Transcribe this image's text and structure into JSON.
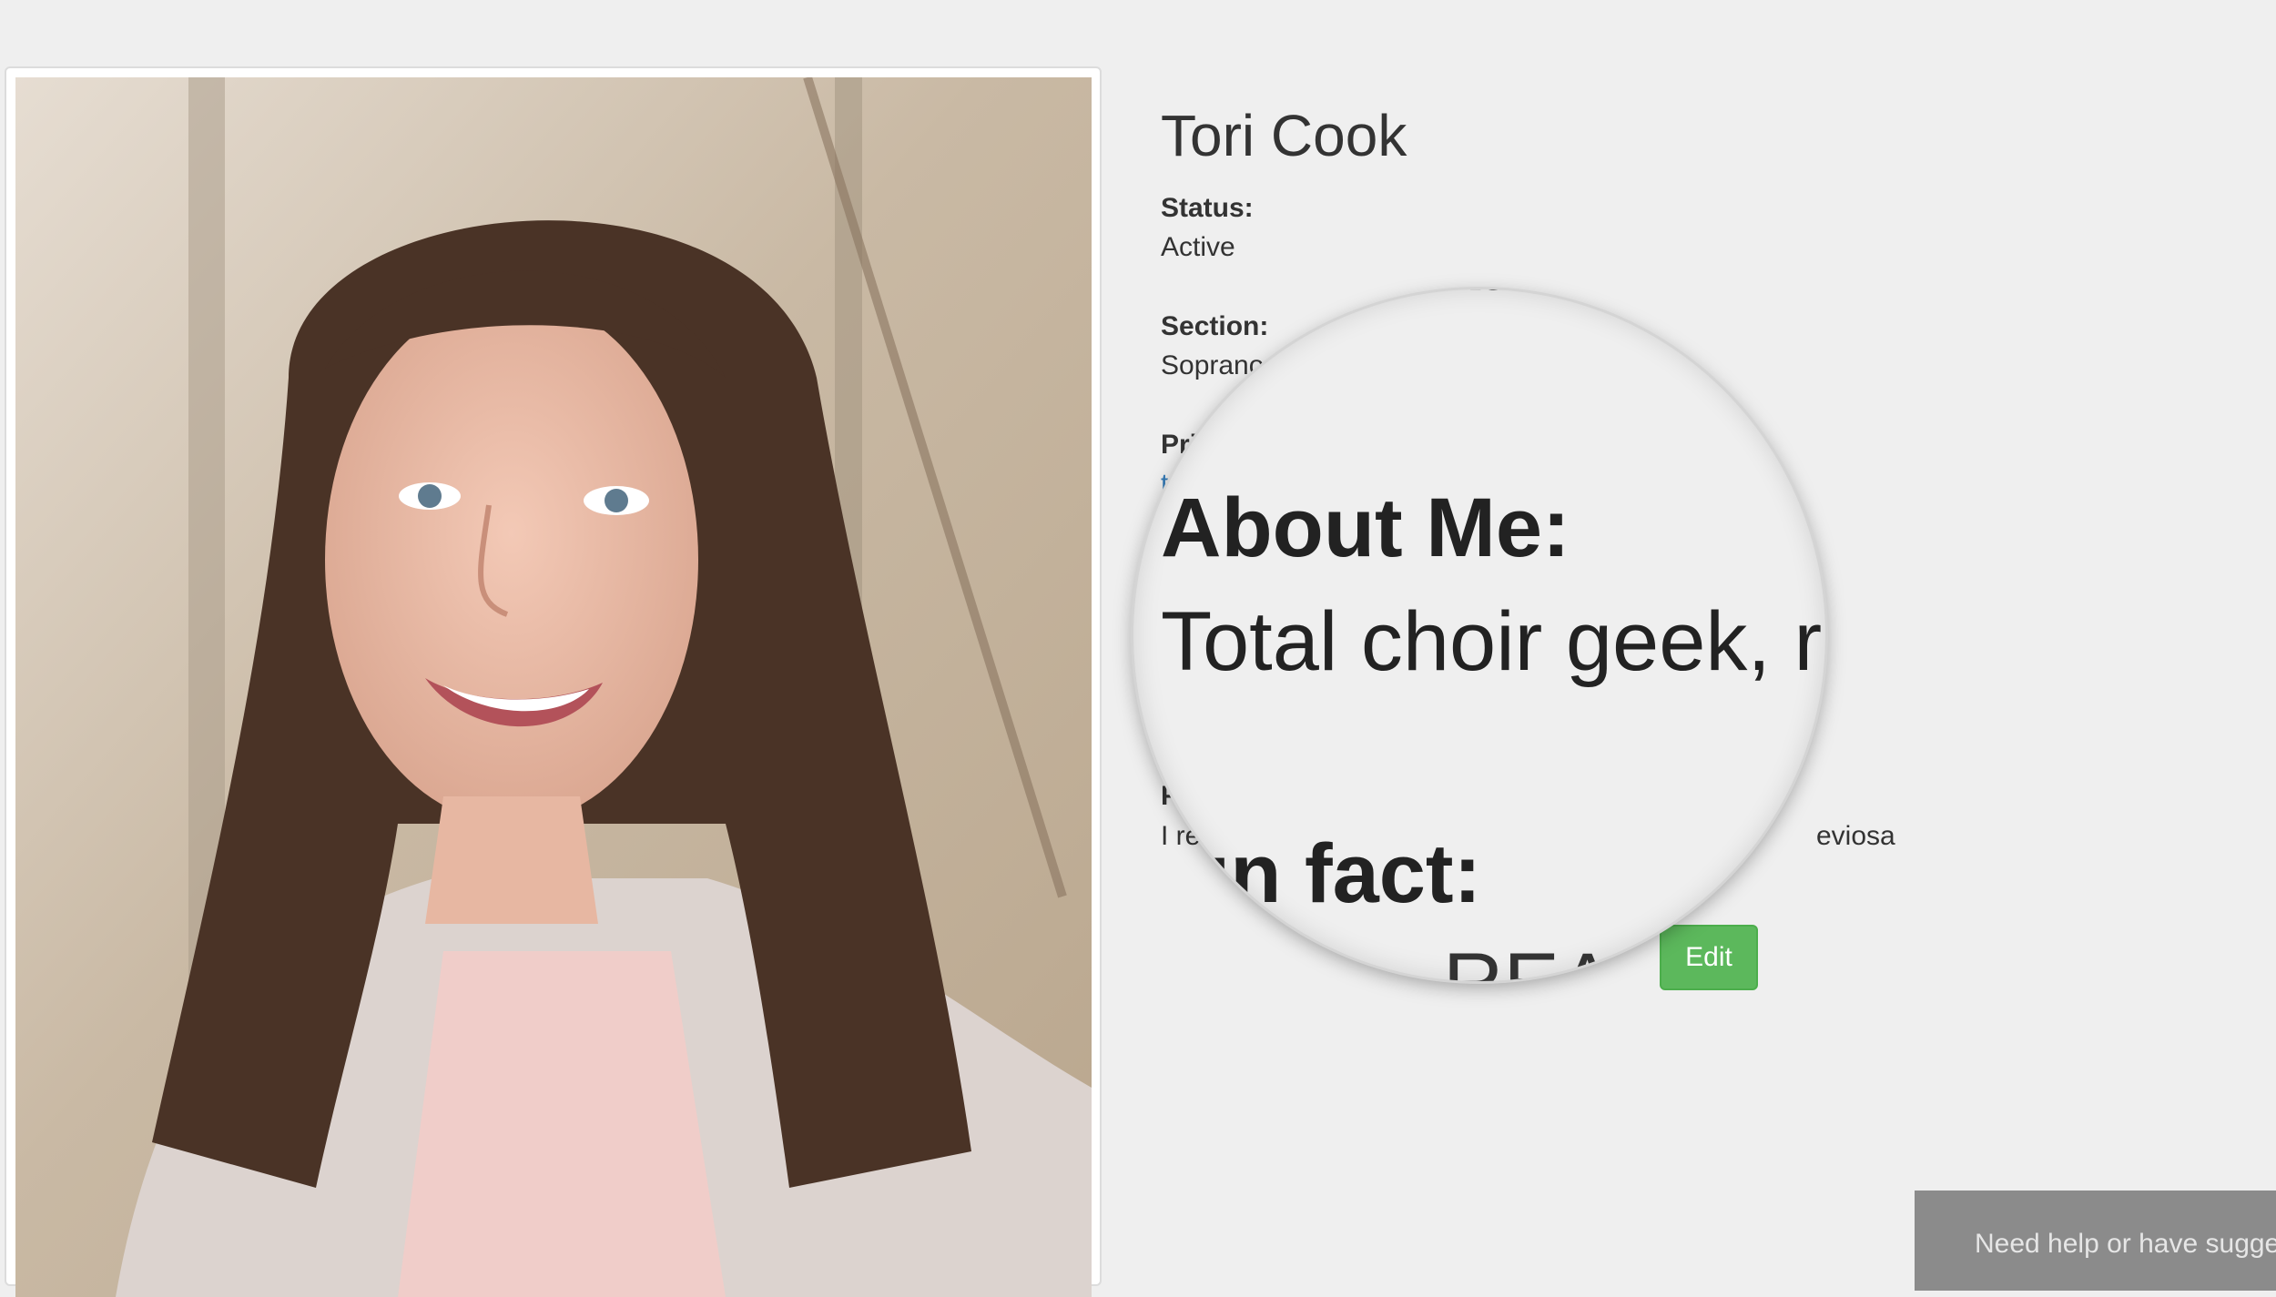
{
  "profile": {
    "name": "Tori Cook",
    "photo_alt": "Tori Cook",
    "status": {
      "label": "Status:",
      "value": "Active"
    },
    "section": {
      "label": "Section:",
      "value": "Soprano"
    },
    "primary": {
      "label_partial": "Pri",
      "value_partial": "to"
    },
    "fun_fact": {
      "label_partial": "Fu",
      "value_left": "I rea",
      "value_right": "eviosa"
    },
    "edit_label": "Edit"
  },
  "magnifier": {
    "top_fragment": "embe",
    "about_label": "About Me:",
    "about_text": "Total choir geek, r",
    "fun_fact_fragment": "un fact:",
    "bottom_fragment": "REA"
  },
  "help_widget": {
    "label": "Need help or have sugge"
  },
  "colors": {
    "background": "#efefef",
    "edit_button": "#5cb85c",
    "link": "#337ab7",
    "help_widget": "#8b8b8b"
  }
}
